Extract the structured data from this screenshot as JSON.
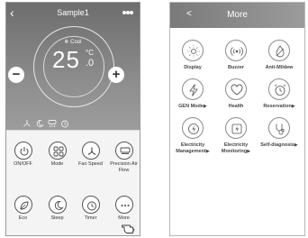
{
  "main_screen": {
    "title": "Sample1",
    "back_icon": "chevron-left-icon",
    "menu_icon": "more-dots-icon",
    "mode_text": "Cool",
    "mode_icon": "snowflake-icon",
    "temp_integer": "25",
    "temp_unit": "°C",
    "temp_decimal": ".0",
    "minus_label": "−",
    "plus_label": "+",
    "state_icons": [
      "fan-speed-icon",
      "sleep-icon",
      "precision-airflow-icon",
      "timer-icon"
    ],
    "functions": [
      {
        "label": "ON/OFF",
        "icon": "power-icon"
      },
      {
        "label": "Mode",
        "icon": "mode-grid-icon"
      },
      {
        "label": "Fan Speed",
        "icon": "fan-icon"
      },
      {
        "label": "Precision Air Flow",
        "icon": "airflow-icon"
      },
      {
        "label": "Eco",
        "icon": "leaf-icon"
      },
      {
        "label": "Sleep",
        "icon": "moon-icon"
      },
      {
        "label": "Timer",
        "icon": "clock-icon"
      },
      {
        "label": "More",
        "icon": "ellipsis-icon"
      }
    ]
  },
  "more_screen": {
    "title": "More",
    "back_label": "<",
    "items": [
      {
        "label": "Display",
        "icon": "sun-icon",
        "arrow": ""
      },
      {
        "label": "Buzzer",
        "icon": "buzzer-icon",
        "arrow": ""
      },
      {
        "label": "Anti-Mildew",
        "icon": "anti-mildew-icon",
        "arrow": ""
      },
      {
        "label": "GEN Mode",
        "icon": "lightning-icon",
        "arrow": "▶"
      },
      {
        "label": "Health",
        "icon": "heart-icon",
        "arrow": ""
      },
      {
        "label": "Reservation",
        "icon": "alarm-clock-icon",
        "arrow": "▶"
      },
      {
        "label": "Electricity Management",
        "icon": "power-management-icon",
        "arrow": "▶"
      },
      {
        "label": "Electricity Monitoring",
        "icon": "power-monitoring-icon",
        "arrow": "▶"
      },
      {
        "label": "Self-diagnosis",
        "icon": "stethoscope-icon",
        "arrow": "▶"
      }
    ]
  }
}
